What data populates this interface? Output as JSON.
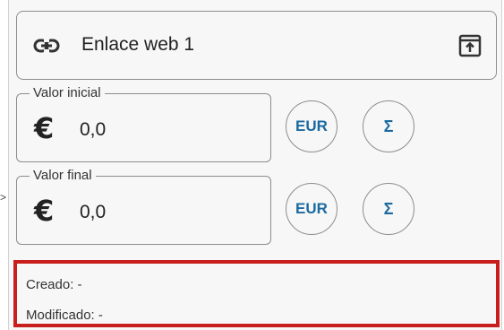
{
  "left_marker": ">",
  "link_row": {
    "label": "Enlace web 1",
    "icon": "link-icon",
    "action_icon": "open-in-new-icon"
  },
  "fields": [
    {
      "legend": "Valor inicial",
      "currency_icon": "€",
      "value": "0,0",
      "currency_button": "EUR",
      "sum_button": "Σ"
    },
    {
      "legend": "Valor final",
      "currency_icon": "€",
      "value": "0,0",
      "currency_button": "EUR",
      "sum_button": "Σ"
    }
  ],
  "info": {
    "created": "Creado: -",
    "modified": "Modificado: -"
  },
  "colors": {
    "accent_text": "#1b6aa0",
    "highlight_border": "#c81e1e",
    "border": "#8d8d8d",
    "background": "#f7f7f7"
  }
}
